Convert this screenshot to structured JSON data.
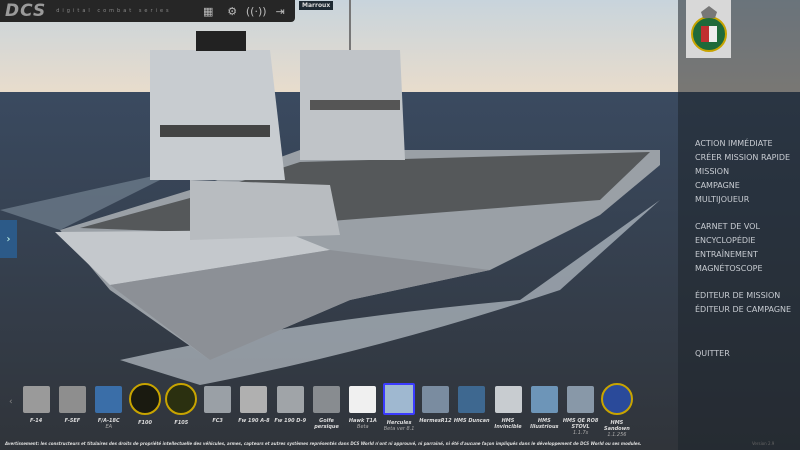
{
  "topbar": {
    "logo": "DCS",
    "tagline": "digital combat series",
    "icons": [
      "modules-grid-icon",
      "settings-gear-icon",
      "network-signal-icon",
      "exit-icon"
    ]
  },
  "tooltip": "Marroux",
  "menu": {
    "items": [
      "ACTION IMMÉDIATE",
      "CRÉER MISSION RAPIDE",
      "MISSION",
      "CAMPAGNE",
      "MULTIJOUEUR",
      "CARNET DE VOL",
      "ENCYCLOPÉDIE",
      "ENTRAÎNEMENT",
      "MAGNÉTOSCOPE",
      "ÉDITEUR DE MISSION",
      "ÉDITEUR DE CAMPAGNE",
      "QUITTER"
    ]
  },
  "modules": [
    {
      "label": "F-14",
      "sub": "",
      "color": "#9a9a9a"
    },
    {
      "label": "F-5EF",
      "sub": "",
      "color": "#8e8e8e"
    },
    {
      "label": "F/A-18C",
      "sub": "EA",
      "color": "#3a6ea8"
    },
    {
      "label": "F100",
      "sub": "",
      "color": "#1a1a10",
      "round": true
    },
    {
      "label": "F105",
      "sub": "",
      "color": "#2b3010",
      "round": true
    },
    {
      "label": "FC3",
      "sub": "",
      "color": "#9aa0a6"
    },
    {
      "label": "Fw 190 A-8",
      "sub": "",
      "color": "#b0b0b0"
    },
    {
      "label": "Fw 190 D-9",
      "sub": "",
      "color": "#a0a4a8"
    },
    {
      "label": "Golfe persique",
      "sub": "",
      "color": "#888c90"
    },
    {
      "label": "Hawk T1A",
      "sub": "Beta",
      "color": "#f0f0f0"
    },
    {
      "label": "Hercules",
      "sub": "Beta ver 8.1",
      "color": "#9fb8d0",
      "selected": true
    },
    {
      "label": "HermesR12",
      "sub": "",
      "color": "#7a8ca0"
    },
    {
      "label": "HMS Duncan",
      "sub": "",
      "color": "#3e6890"
    },
    {
      "label": "HMS Invincible",
      "sub": "",
      "color": "#c8ccd0"
    },
    {
      "label": "HMS Illustrious",
      "sub": "",
      "color": "#6d95b8"
    },
    {
      "label": "HMS QE RO8 STOVL",
      "sub": "1.1.7s",
      "color": "#8898a8"
    },
    {
      "label": "HMS Sandown",
      "sub": "1.1.256",
      "color": "#2a4a9a",
      "round": true
    }
  ],
  "footer": "Avertissement: les constructeurs et titulaires des droits de propriété intellectuelle des véhicules, armes, capteurs et autres systèmes représentés dans DCS World n'ont ni approuvé, ni parrainé, ni été d'aucune façon impliqués dans le développement de DCS World ou ses modules.",
  "version": "Version 2.9",
  "colors": {
    "accent": "#3b3bff",
    "panel": "#1e242c",
    "topbar": "#262626"
  }
}
